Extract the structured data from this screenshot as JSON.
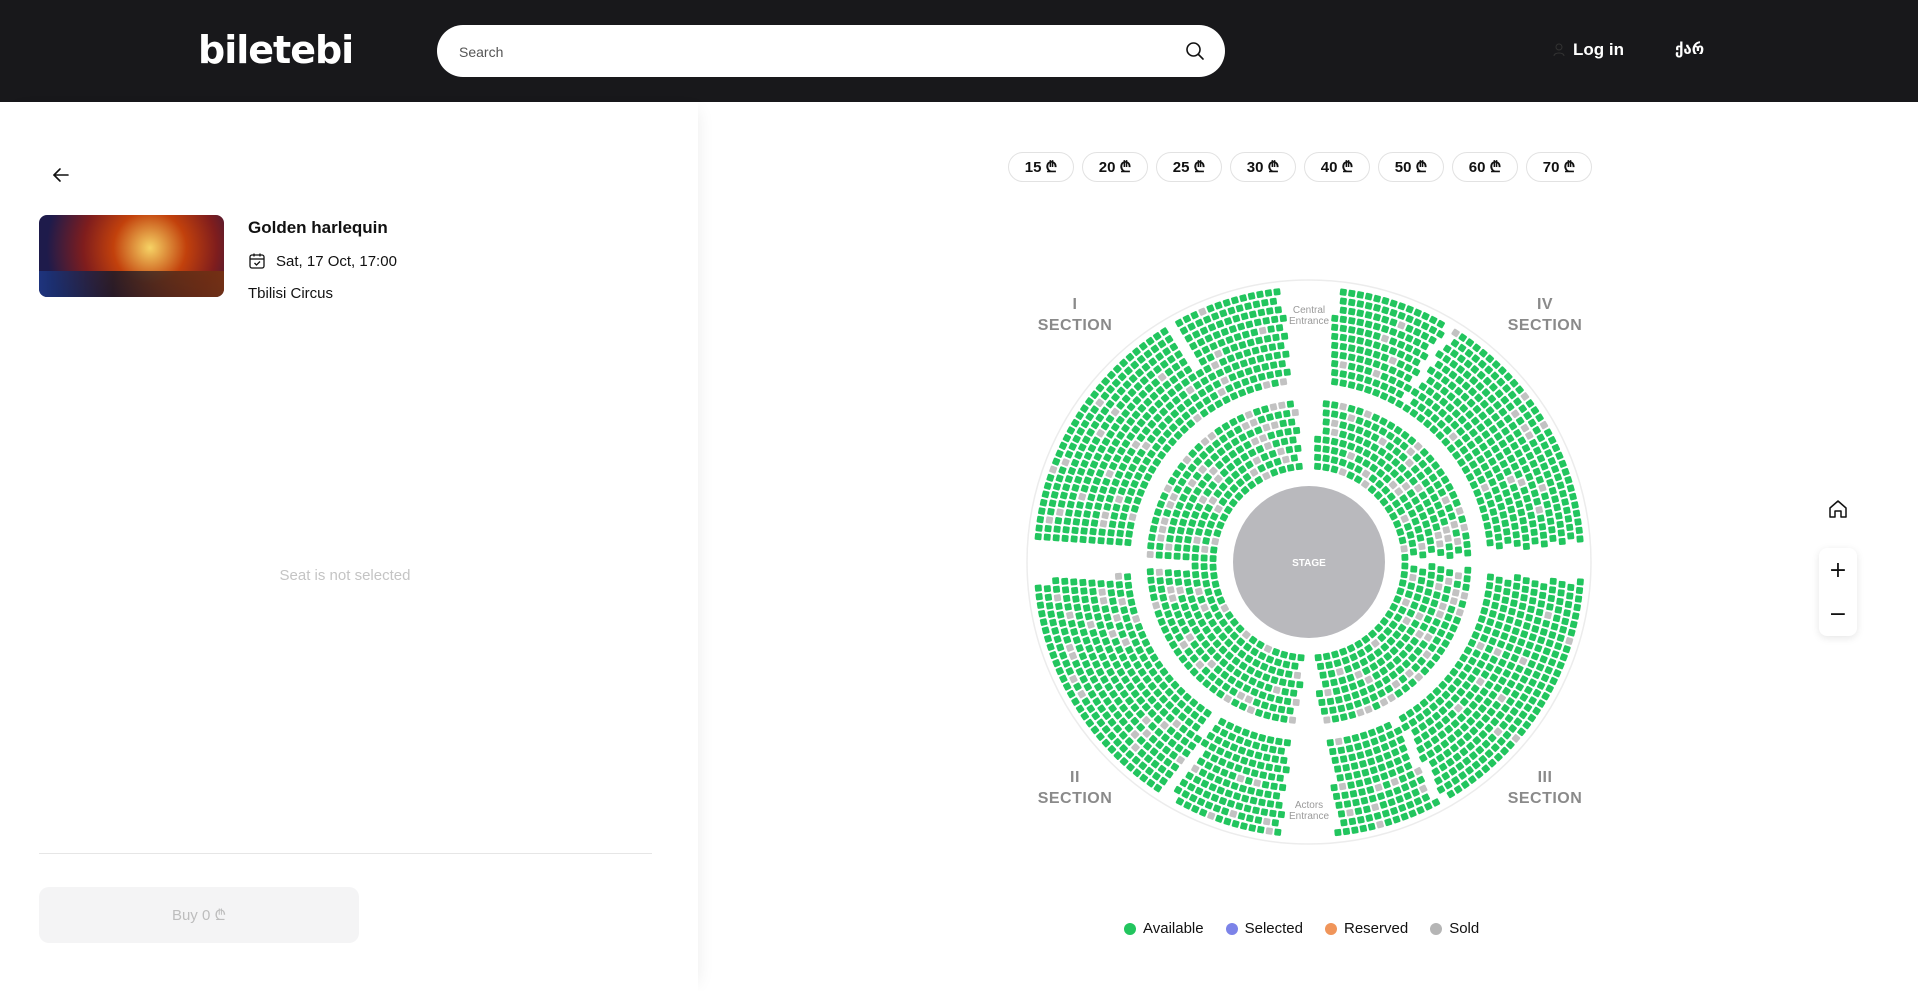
{
  "header": {
    "logo": "biletebi",
    "search_placeholder": "Search",
    "login_label": "Log in",
    "language_label": "ქარ"
  },
  "event": {
    "title": "Golden harlequin",
    "date": "Sat, 17 Oct, 17:00",
    "venue": "Tbilisi Circus"
  },
  "selection": {
    "empty_message": "Seat is not selected",
    "buy_label": "Buy 0 ₾"
  },
  "price_filters": [
    "15 ₾",
    "20 ₾",
    "25 ₾",
    "30 ₾",
    "40 ₾",
    "50 ₾",
    "60 ₾",
    "70 ₾"
  ],
  "seat_map": {
    "stage_label": "STAGE",
    "sections": [
      {
        "num": "I",
        "label": "SECTION"
      },
      {
        "num": "IV",
        "label": "SECTION"
      },
      {
        "num": "II",
        "label": "SECTION"
      },
      {
        "num": "III",
        "label": "SECTION"
      }
    ],
    "entrances": {
      "central": [
        "Central",
        "Entrance"
      ],
      "actors": [
        "Actors",
        "Entrance"
      ]
    }
  },
  "legend": [
    {
      "label": "Available",
      "color": "#22c55e"
    },
    {
      "label": "Selected",
      "color": "#7c83e8"
    },
    {
      "label": "Reserved",
      "color": "#f0955a"
    },
    {
      "label": "Sold",
      "color": "#b5b5b5"
    }
  ],
  "colors": {
    "header_bg": "#18181b",
    "available": "#22c55e",
    "sold": "#c2c2c2",
    "stage": "#b9b9bd"
  }
}
